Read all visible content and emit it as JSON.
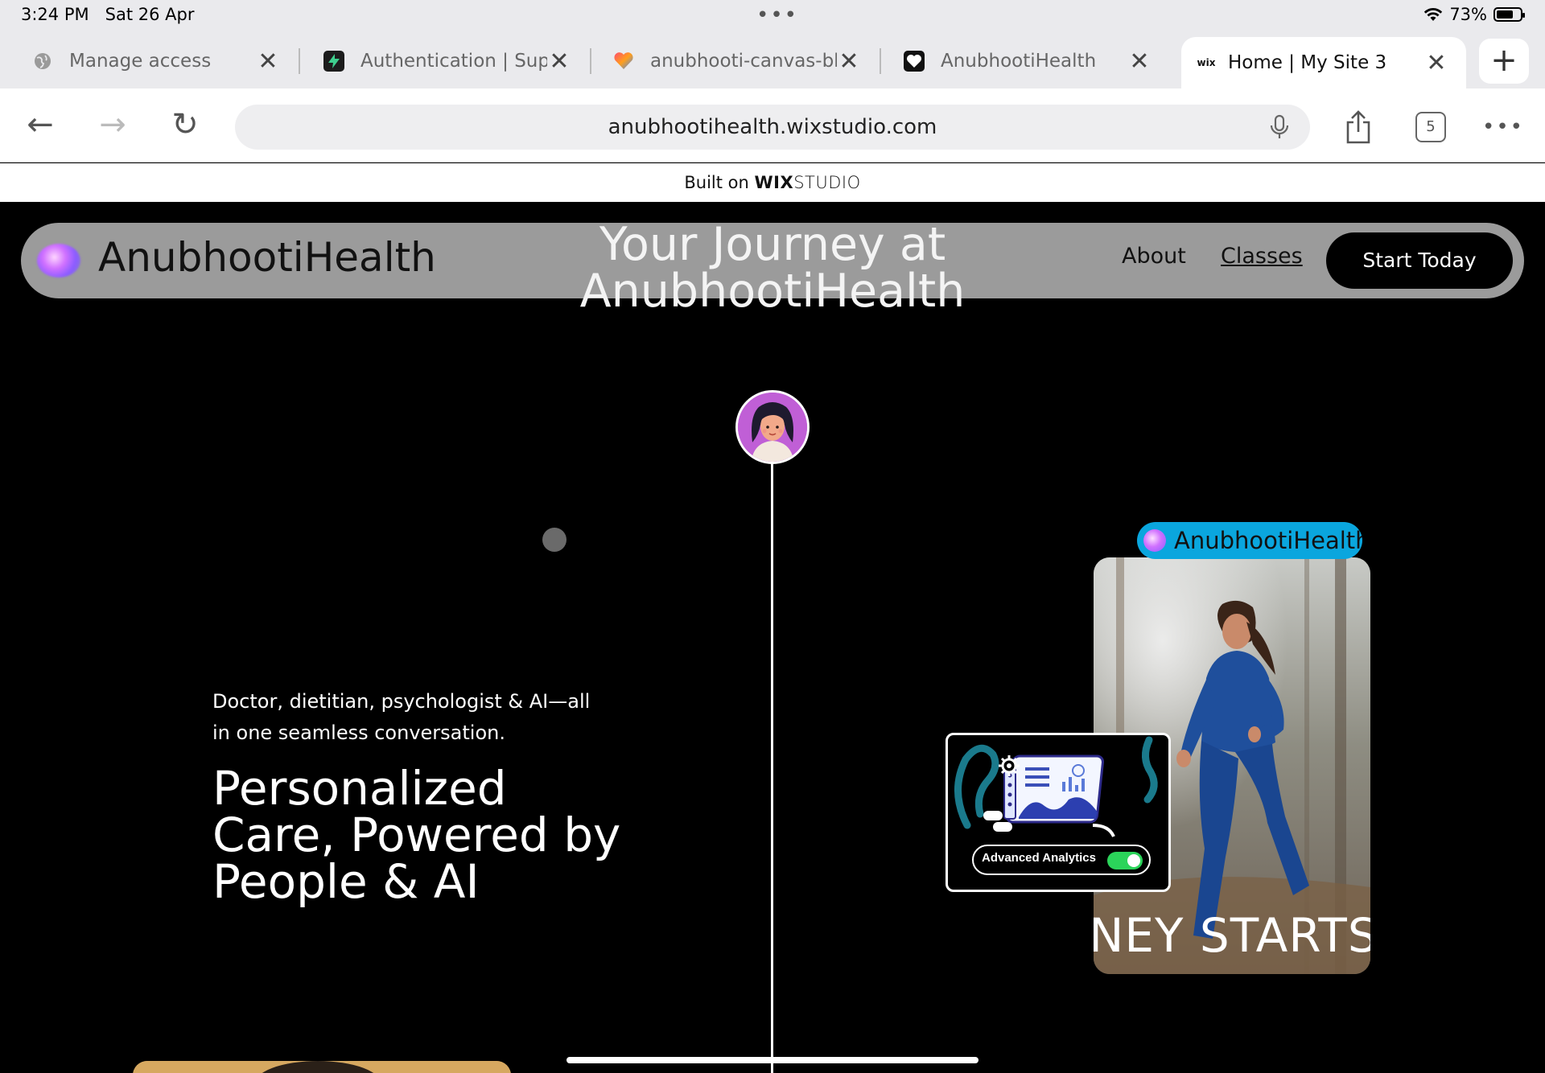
{
  "status": {
    "time": "3:24 PM",
    "date": "Sat 26 Apr",
    "battery_text": "73%",
    "battery_level": 0.73,
    "more_glyph": "•••"
  },
  "tabs": [
    {
      "title": "Manage access",
      "icon": "globe-icon",
      "active": false
    },
    {
      "title": "Authentication | Supa",
      "icon": "supabase-icon",
      "active": false
    },
    {
      "title": "anubhooti-canvas-bl",
      "icon": "heart-icon",
      "active": false
    },
    {
      "title": "AnubhootiHealth",
      "icon": "heart-outline-icon",
      "active": false
    },
    {
      "title": "Home | My Site 3",
      "icon": "wix-icon",
      "active": true
    }
  ],
  "toolbar": {
    "url": "anubhootihealth.wixstudio.com",
    "tab_count": "5",
    "back_glyph": "←",
    "forward_glyph": "→",
    "reload_glyph": "↻",
    "more_glyph": "•••",
    "newtab_glyph": "+",
    "close_glyph": "✕",
    "wix_favicon_text": "wix"
  },
  "banner": {
    "prefix": "Built on ",
    "brand": "WIX",
    "suffix": "STUDIO"
  },
  "site": {
    "brand": "AnubhootiHealth",
    "nav": {
      "about": "About",
      "classes": "Classes",
      "cta": "Start Today"
    },
    "hero_title": "Your Journey at AnubhootiHealth",
    "subcopy": "Doctor, dietitian, psychologist & AI—all in one seamless conversation.",
    "headline": "Personalized Care, Powered by People & AI",
    "pill_label": "AnubhootiHealth",
    "photo_overlay": "NEY STARTS",
    "analytics_label": "Advanced Analytics",
    "analytics_toggle_on": true
  },
  "colors": {
    "pill": "#0aa6de",
    "nav_bg": "#9b9b9b",
    "avatar_bg": "#c05fd6",
    "toggle_on": "#2bd45a"
  }
}
